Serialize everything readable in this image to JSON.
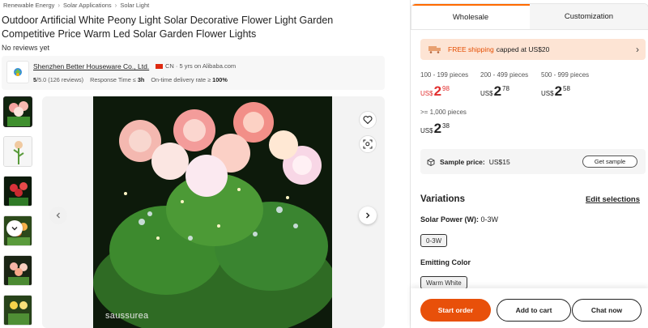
{
  "breadcrumb": [
    "Renewable Energy",
    "Solar Applications",
    "Solar Light"
  ],
  "product": {
    "title": "Outdoor Artificial White Peony Light Solar Decorative Flower Light Garden Competitive Price Warm Led Solar Garden Flower Lights",
    "reviews": "No reviews yet",
    "watermark": "saussurea"
  },
  "supplier": {
    "name": "Shenzhen Better Houseware Co., Ltd.",
    "meta": "CN · 5 yrs on Alibaba.com",
    "rating": "5",
    "rating_suffix": "/5.0 (126 reviews)",
    "response_label": "Response Time ≤",
    "response_value": "3h",
    "ontime_label": "On-time delivery rate ≥",
    "ontime_value": "100%"
  },
  "tabs": [
    "Wholesale",
    "Customization"
  ],
  "shipping": {
    "free": "FREE shipping",
    "rest": "capped at US$20"
  },
  "tiers": [
    {
      "qty": "100 - 199 pieces",
      "cur": "US$",
      "whole": "2",
      "cents": "98"
    },
    {
      "qty": "200 - 499 pieces",
      "cur": "US$",
      "whole": "2",
      "cents": "78"
    },
    {
      "qty": "500 - 999 pieces",
      "cur": "US$",
      "whole": "2",
      "cents": "58"
    },
    {
      "qty": ">= 1,000 pieces",
      "cur": "US$",
      "whole": "2",
      "cents": "38"
    }
  ],
  "sample": {
    "label": "Sample price:",
    "value": "US$15",
    "button": "Get sample"
  },
  "variations": {
    "title": "Variations",
    "edit": "Edit selections",
    "power_label": "Solar Power (W):",
    "power_value": "0-3W",
    "power_chip": "0-3W",
    "color_label": "Emitting Color",
    "color_chip": "Warm White"
  },
  "actions": {
    "order": "Start order",
    "cart": "Add to cart",
    "chat": "Chat now"
  },
  "colors": {
    "accent": "#e8500a",
    "price_red": "#e22e2e",
    "shipping_bg": "#fde4d4"
  }
}
